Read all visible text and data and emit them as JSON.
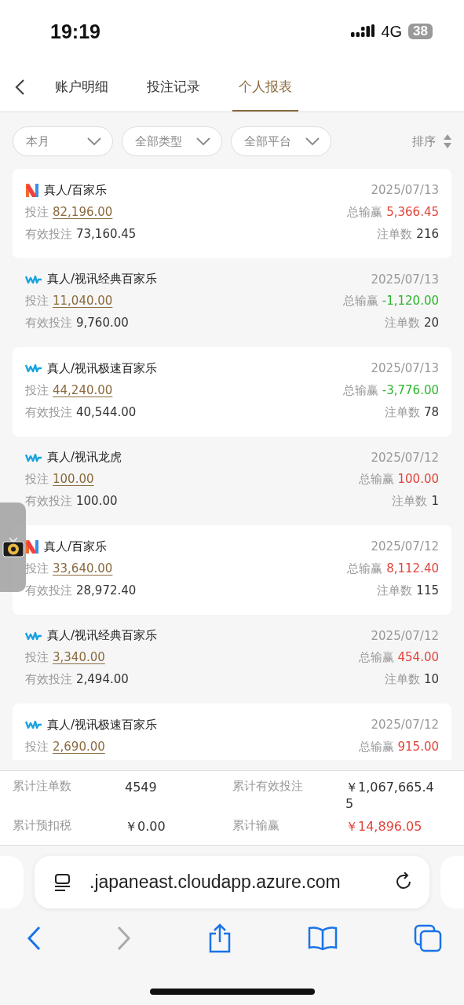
{
  "status_bar": {
    "time": "19:19",
    "network": "4G",
    "battery": "38"
  },
  "tabs": [
    {
      "label": "账户明细",
      "selected": false
    },
    {
      "label": "投注记录",
      "selected": false
    },
    {
      "label": "个人报表",
      "selected": true
    }
  ],
  "filters": [
    {
      "label": "本月"
    },
    {
      "label": "全部类型"
    },
    {
      "label": "全部平台"
    }
  ],
  "sort": {
    "label": "排序"
  },
  "records": [
    {
      "kind": "n",
      "game": "真人/百家乐",
      "date": "2025/07/13",
      "bet_label": "投注",
      "bet": "82,196.00",
      "total_label": "总输赢",
      "total": "5,366.45",
      "color": "#e0443a",
      "valid_label": "有效投注",
      "valid": "73,160.45",
      "count_label": "注单数",
      "count": "216"
    },
    {
      "kind": "wm",
      "game": "真人/视讯经典百家乐",
      "date": "2025/07/13",
      "bet_label": "投注",
      "bet": "11,040.00",
      "total_label": "总输赢",
      "total": "-1,120.00",
      "color": "#2cb52c",
      "valid_label": "有效投注",
      "valid": "9,760.00",
      "count_label": "注单数",
      "count": "20"
    },
    {
      "kind": "wm",
      "game": "真人/视讯极速百家乐",
      "date": "2025/07/13",
      "bet_label": "投注",
      "bet": "44,240.00",
      "total_label": "总输赢",
      "total": "-3,776.00",
      "color": "#2cb52c",
      "valid_label": "有效投注",
      "valid": "40,544.00",
      "count_label": "注单数",
      "count": "78"
    },
    {
      "kind": "wm",
      "game": "真人/视讯龙虎",
      "date": "2025/07/12",
      "bet_label": "投注",
      "bet": "100.00",
      "total_label": "总输赢",
      "total": "100.00",
      "color": "#e0443a",
      "valid_label": "有效投注",
      "valid": "100.00",
      "count_label": "注单数",
      "count": "1"
    },
    {
      "kind": "n",
      "game": "真人/百家乐",
      "date": "2025/07/12",
      "bet_label": "投注",
      "bet": "33,640.00",
      "total_label": "总输赢",
      "total": "8,112.40",
      "color": "#e0443a",
      "valid_label": "有效投注",
      "valid": "28,972.40",
      "count_label": "注单数",
      "count": "115"
    },
    {
      "kind": "wm",
      "game": "真人/视讯经典百家乐",
      "date": "2025/07/12",
      "bet_label": "投注",
      "bet": "3,340.00",
      "total_label": "总输赢",
      "total": "454.00",
      "color": "#e0443a",
      "valid_label": "有效投注",
      "valid": "2,494.00",
      "count_label": "注单数",
      "count": "10"
    },
    {
      "kind": "wm",
      "game": "真人/视讯极速百家乐",
      "date": "2025/07/12",
      "bet_label": "投注",
      "bet": "2,690.00",
      "total_label": "总输赢",
      "total": "915.00",
      "color": "#e0443a"
    }
  ],
  "summary": [
    {
      "label": "累计注单数",
      "value": "4549",
      "color": "#333333"
    },
    {
      "label": "累计有效投注",
      "value": "￥1,067,665.45",
      "color": "#333333"
    },
    {
      "label": "累计预扣税",
      "value": "￥0.00",
      "color": "#333333"
    },
    {
      "label": "累计输赢",
      "value": "￥14,896.05",
      "color": "#e0443a"
    }
  ],
  "browser": {
    "url": ".japaneast.cloudapp.azure.com"
  }
}
